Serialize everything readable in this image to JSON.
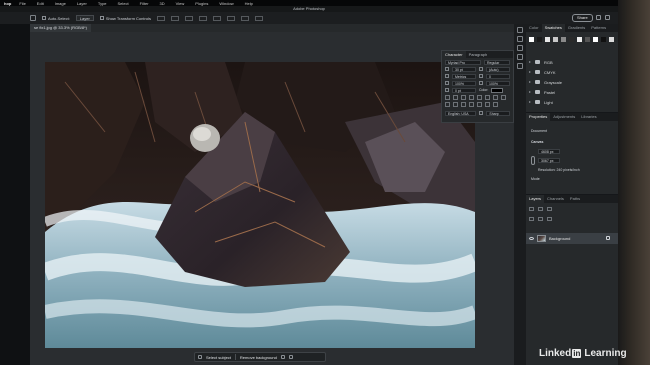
{
  "menubar": {
    "app_name": "hop",
    "items": [
      "File",
      "Edit",
      "Image",
      "Layer",
      "Type",
      "Select",
      "Filter",
      "3D",
      "View",
      "Plugins",
      "Window",
      "Help"
    ]
  },
  "window": {
    "title": "Adobe Photoshop"
  },
  "options_bar": {
    "auto_select_label": "Auto-Select:",
    "auto_select_value": "Layer",
    "show_transform_label": "Show Transform Controls",
    "share_label": "Share"
  },
  "document": {
    "tab_label": "se fix1.jpg @ 33.3% (RGB/8*)"
  },
  "character_panel": {
    "tabs": [
      "Character",
      "Paragraph"
    ],
    "font_family": "Myriad Pro",
    "font_style": "Regular",
    "font_size": "30 pt",
    "leading": "(Auto)",
    "kerning": "Metrics",
    "tracking": "0",
    "vertical_scale": "100%",
    "horizontal_scale": "100%",
    "baseline": "0 pt",
    "color_label": "Color:",
    "language": "English: USA",
    "antialias": "Sharp"
  },
  "swatches_panel": {
    "tabs": [
      "Color",
      "Swatches",
      "Gradients",
      "Patterns"
    ],
    "swatch_colors": [
      "#ffffff",
      "#1a1a1a",
      "#e8e8e8",
      "#c8c8c8",
      "#8a8a8a",
      "#2a2a2a",
      "#f0f0f0",
      "#555555",
      "#ffffff",
      "#111111",
      "#dcdcdc"
    ],
    "groups": [
      "RGB",
      "CMYK",
      "Grayscale",
      "Pastel",
      "Light"
    ]
  },
  "properties_panel": {
    "tabs": [
      "Properties",
      "Adjustments",
      "Libraries"
    ],
    "doc_type": "Document",
    "section": "Canvas",
    "width": "4608 px",
    "height": "3067 px",
    "resolution": "Resolution: 240 pixels/inch",
    "mode": "Mode"
  },
  "layers_panel": {
    "tabs": [
      "Layers",
      "Channels",
      "Paths"
    ],
    "layer_name": "Background"
  },
  "taskbar": {
    "select_subject": "Select subject",
    "remove_background": "Remove background"
  },
  "watermark": {
    "pre": "Linked",
    "in": "in",
    "post": "Learning"
  }
}
